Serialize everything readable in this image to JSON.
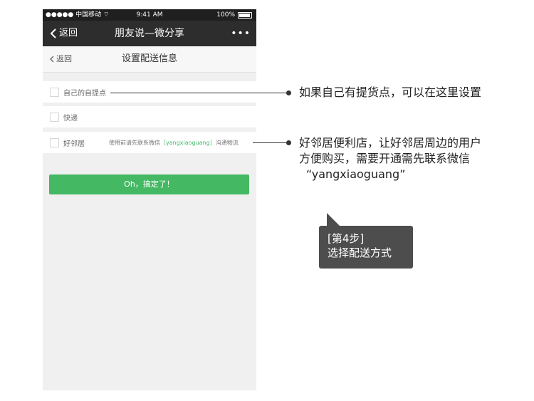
{
  "statusbar": {
    "carrier": "●●●●● 中国移动 ",
    "time": "9:41 AM",
    "battery": "100%"
  },
  "wechat_nav": {
    "back_label": "返回",
    "title": "朋友说—微分享",
    "more": "•••"
  },
  "page_nav": {
    "back_label": "返回",
    "title": "设置配送信息"
  },
  "options": [
    {
      "label": "自己的自提点"
    },
    {
      "label": "快递"
    },
    {
      "label": "好邻居",
      "note_prefix": "使用前请先联系微信",
      "note_highlight": "［yangxiaoguang］",
      "note_suffix": "沟通物流"
    }
  ],
  "confirm_button": "Oh，搞定了！",
  "annotations": {
    "self_pickup": "如果自己有提货点，可以在这里设置",
    "neighbor_line1": "好邻居便利店，让好邻居周边的用户",
    "neighbor_line2": "方便购买，需要开通需先联系微信",
    "neighbor_line3": "“yangxiaoguang”"
  },
  "callout": {
    "step": "[第4步]",
    "text": "选择配送方式"
  },
  "colors": {
    "accent_green": "#44b863",
    "nav_dark": "#2d2d2d",
    "callout_bg": "#4d4d4d"
  },
  "icons": {
    "back": "chevron-left-icon",
    "wifi": "wifi-icon",
    "battery": "battery-icon",
    "more": "more-dots-icon"
  }
}
